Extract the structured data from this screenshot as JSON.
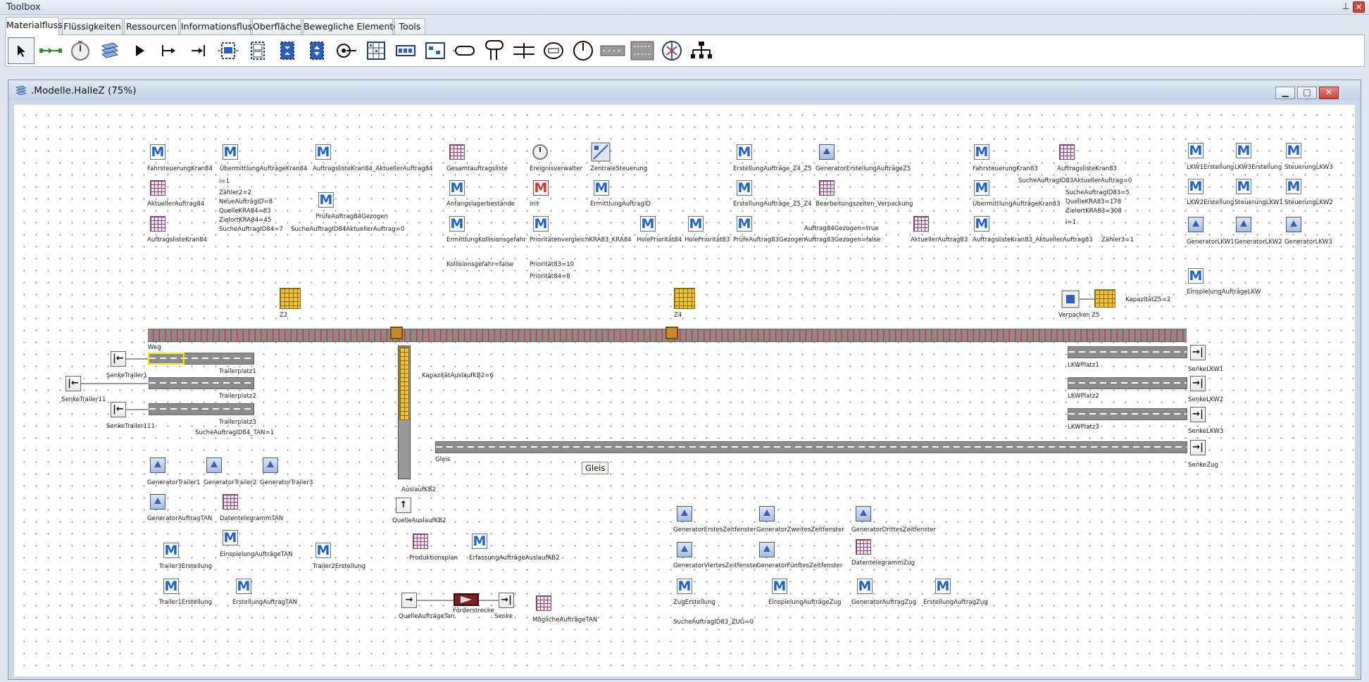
{
  "toolbox_title": "Toolbox",
  "tabs": [
    "Materialfluss",
    "Flüssigkeiten",
    "Ressourcen",
    "Informationsfluss",
    "Oberfläche",
    "Bewegliche Elemente",
    "Tools"
  ],
  "toolbar_tools": [
    "pointer-icon",
    "connector-icon",
    "event-controller-icon",
    "frame-icon",
    "source-icon",
    "single-proc-icon",
    "drain-icon",
    "buffer-icon",
    "parallel-proc-icon",
    "assembly-icon",
    "dismantle-icon",
    "cycle-icon",
    "store-icon",
    "line-icon",
    "sorter-icon",
    "track-icon",
    "twolane-track-icon",
    "turntable-icon",
    "turnplate-icon",
    "placebuffer-icon",
    "shift-icon",
    "distributor-icon",
    "flowcontrol-icon",
    "sync-icon"
  ],
  "window": {
    "title": ".Modelle.HalleZ  (75%)"
  },
  "tooltip": "Gleis",
  "labels": [
    "FahrsteuerungKran84",
    "ÜbermittlungAufträgeKran84",
    "AuftragslisteKran84_AktuellerAuftrag84",
    "Gesamtauftragsliste",
    "Ereignisverwalter",
    "ZentraleSteuerung",
    "ErstellungAufträge_Z4_Z5",
    "GeneratorErstellungAufträgeZ5",
    "FahrsteuerungKran83",
    "AuftragslisteKran83",
    "LKW1Erstellung",
    "LKW3Erstellung",
    "SteuerungLKW3",
    "i=1",
    "AktuellerAuftrag84",
    "Zähler2=2",
    "NeueAuftragID=8",
    "QuelleKRA84=83",
    "ZielortKRA84=45",
    "SucheAuftragID84=7",
    "PrüfeAuftrag84Gezogen",
    "SucheAuftragID84AktuellerAuftrag=0",
    "AuftragslisteKran84",
    "Anfangslagerbestände",
    "init",
    "ErmittlungAuftragID",
    "ErstellungAufträge_Z5_Z4",
    "Bearbeitungszeiten_Verpackung",
    "ÜbermittlungAufträgeKran83",
    "SucheAuftragID83AktuellerAuftrag=0",
    "SucheAuftragID83=5",
    "QuelleKRA83=178",
    "ZielortKRA83=308",
    "i=1",
    "LKW2Erstellung",
    "SteuerungLKW1",
    "SteuerungLKW2",
    "ErmittlungKollisionsgefahr",
    "PrioritätenvergleichKRA83_KRA84",
    "HolePriorität84",
    "HolePriorität83",
    "PrüfeAuftrag83Gezogen",
    "Auftrag84Gezogen=true",
    "Auftrag83Gezogen=false",
    "AktuellerAuftrag83",
    "AuftragslisteKran83_AktuellerAuftrag83",
    "Zähler3=1",
    "GeneratorLKW1",
    "GeneratorLKW2",
    "GeneratorLKW3",
    "Kollisionsgefahr=false",
    "Priorität83=10",
    "Priorität84=8",
    "EinspielungAufträgeLKW",
    "Z2",
    "Z4",
    "Verpacken",
    "Z5",
    "KapazitätZ5=2",
    "Weg",
    "SenkeTrailer1",
    "Trailerplatz1",
    "SenkeTrailer11",
    "Trailerplatz2",
    "SenkeTrailer111",
    "Trailerplatz3",
    "SucheAuftragID84_TAN=1",
    "KapazitätAuslaufKB2=6",
    "LKWPlatz1",
    "SenkeLKW1",
    "LKWPlatz2",
    "SenkeLKW2",
    "LKWPlatz3",
    "SenkeLKW3",
    "Gleis",
    "SenkeZug",
    "AuslaufKB2",
    "QuelleAuslaufKB2",
    "GeneratorTrailer1",
    "GeneratorTrailer2",
    "GeneratorTrailer3",
    "GeneratorAuftragTAN",
    "DatentelegrammTAN",
    "EinspielungAufträgeTAN",
    "Trailer3Erstellung",
    "Trailer2Erstellung",
    "Trailer1Erstellung",
    "ErstellungAuftragTAN",
    "Produktionsplan",
    "ErfassungAufträgeAuslaufKB2",
    "GeneratorErstesZeitfenster",
    "GeneratorZweitesZeitfenster",
    "GeneratorDrittesZeitfenster",
    "GeneratorViertesZeitfenster",
    "GeneratorFünftesZeitfenster",
    "DatentelegrammZug",
    "ZugErstellung",
    "EinspielungAufträgeZug",
    "GeneratorAuftragZug",
    "ErstellungAuftragZug",
    "SucheAuftragID83_ZUG=0",
    "QuelleAufträgeTan",
    "Förderstrecke",
    "Senke",
    "MöglicheAufträgeTAN"
  ]
}
